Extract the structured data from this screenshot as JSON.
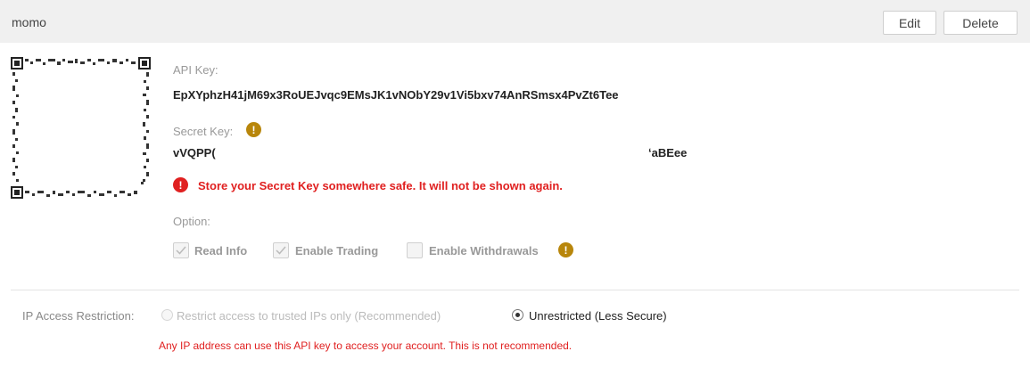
{
  "header": {
    "title": "momo",
    "edit_label": "Edit",
    "delete_label": "Delete"
  },
  "api_key": {
    "label": "API Key:",
    "value": "EpXYphzH41jM69x3RoUEJvqc9EMsJK1vNObY29v1Vi5bxv74AnRSmsx4PvZt6Tee"
  },
  "secret_key": {
    "label": "Secret Key:",
    "value_start": "vVQPP(",
    "value_end": "ʻaBEee",
    "warning": "Store your Secret Key somewhere safe. It will not be shown again."
  },
  "options": {
    "label": "Option:",
    "items": [
      {
        "label": "Read Info",
        "checked": true
      },
      {
        "label": "Enable Trading",
        "checked": true
      },
      {
        "label": "Enable Withdrawals",
        "checked": false
      }
    ]
  },
  "ip_restriction": {
    "label": "IP Access Restriction:",
    "options": [
      {
        "label": "Restrict access to trusted IPs only (Recommended)",
        "selected": false
      },
      {
        "label": "Unrestricted (Less Secure)",
        "selected": true
      }
    ],
    "notice": "Any IP address can use this API key to access your account. This is not recommended."
  },
  "colors": {
    "warning": "#e02020",
    "info": "#b8860b",
    "header_bg": "#f0f0f0"
  }
}
